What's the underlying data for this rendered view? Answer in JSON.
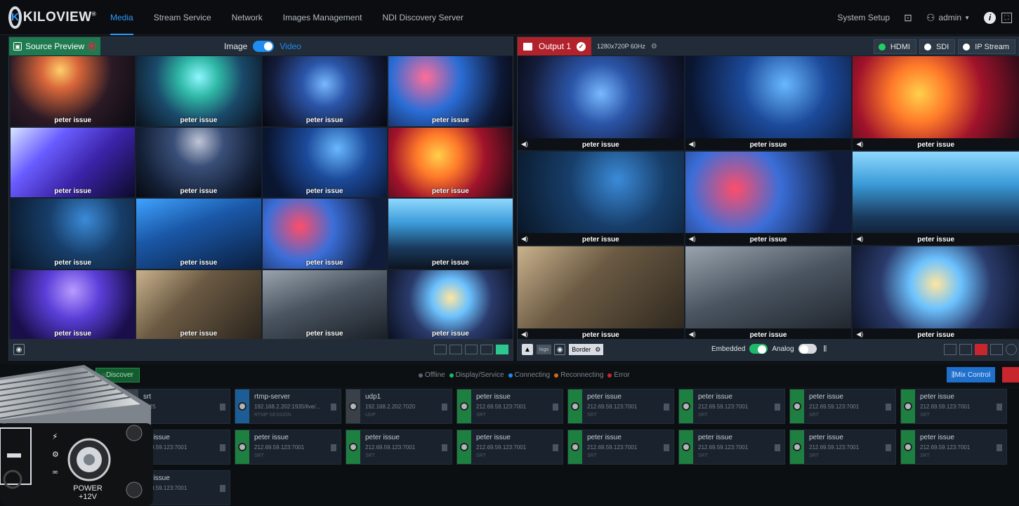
{
  "brand": {
    "name": "KILOVIEW",
    "mark": "®",
    "logo_letter": "K"
  },
  "nav": {
    "items": [
      {
        "label": "Media",
        "active": true
      },
      {
        "label": "Stream Service",
        "active": false
      },
      {
        "label": "Network",
        "active": false
      },
      {
        "label": "Images Management",
        "active": false
      },
      {
        "label": "NDI Discovery Server",
        "active": false
      }
    ]
  },
  "header": {
    "system_setup": "System Setup",
    "user": "admin",
    "info_icon": "i"
  },
  "source_preview": {
    "title": "Source Preview",
    "mode_image": "Image",
    "mode_video": "Video",
    "video_enabled": true,
    "tiles": [
      "peter issue",
      "peter issue",
      "peter issue",
      "peter issue",
      "peter issue",
      "peter issue",
      "peter issue",
      "peter issue",
      "peter issue",
      "peter issue",
      "peter issue",
      "peter issue",
      "peter issue",
      "peter issue",
      "peter issue",
      "peter issue"
    ],
    "layout_options": 5,
    "layout_selected": 5
  },
  "output": {
    "title": "Output 1",
    "resolution": "1280x720P 60Hz",
    "buttons": [
      {
        "label": "HDMI",
        "active": true
      },
      {
        "label": "SDI",
        "active": false
      },
      {
        "label": "IP Stream",
        "active": false
      }
    ],
    "tiles": [
      "peter issue",
      "peter issue",
      "peter issue",
      "peter issue",
      "peter issue",
      "peter issue",
      "peter issue",
      "peter issue",
      "peter issue"
    ],
    "footer": {
      "logo_btn": "logo",
      "border_label": "Border",
      "embedded_label": "Embedded",
      "embedded_on": true,
      "analog_label": "Analog",
      "analog_on": false
    }
  },
  "sources_bar": {
    "discover_label": "Discover",
    "legend": [
      {
        "label": "Offline",
        "color": "#5c6670"
      },
      {
        "label": "Display/Service",
        "color": "#1fb86a"
      },
      {
        "label": "Connecting",
        "color": "#1e8cf0"
      },
      {
        "label": "Reconnecting",
        "color": "#d26a1c"
      },
      {
        "label": "Error",
        "color": "#c8262f"
      }
    ],
    "mix_control_label": "Mix Control"
  },
  "sources": [
    {
      "name": "srt",
      "address": "6025",
      "proto": "",
      "status": "gray"
    },
    {
      "name": "rtmp-server",
      "address": "192.168.2.202:1935/live/...",
      "proto": "RTMP SESSION",
      "status": "blue"
    },
    {
      "name": "udp1",
      "address": "192.168.2.202:7020",
      "proto": "UDP",
      "status": "gray"
    },
    {
      "name": "peter issue",
      "address": "212.69.59.123:7001",
      "proto": "SRT",
      "status": "green"
    },
    {
      "name": "peter issue",
      "address": "212.69.59.123:7001",
      "proto": "SRT",
      "status": "green"
    },
    {
      "name": "peter issue",
      "address": "212.69.59.123:7001",
      "proto": "SRT",
      "status": "green"
    },
    {
      "name": "peter issue",
      "address": "212.69.59.123:7001",
      "proto": "SRT",
      "status": "green"
    },
    {
      "name": "peter issue",
      "address": "212.69.59.123:7001",
      "proto": "SRT",
      "status": "green"
    },
    {
      "name": "ter issue",
      "address": "2.69.59.123:7001",
      "proto": "",
      "status": "gray"
    },
    {
      "name": "peter issue",
      "address": "212.69.59.123:7001",
      "proto": "SRT",
      "status": "green"
    },
    {
      "name": "peter issue",
      "address": "212.69.59.123:7001",
      "proto": "SRT",
      "status": "green"
    },
    {
      "name": "peter issue",
      "address": "212.69.59.123:7001",
      "proto": "SRT",
      "status": "green"
    },
    {
      "name": "peter issue",
      "address": "212.69.59.123:7001",
      "proto": "SRT",
      "status": "green"
    },
    {
      "name": "peter issue",
      "address": "212.69.59.123:7001",
      "proto": "SRT",
      "status": "green"
    },
    {
      "name": "peter issue",
      "address": "212.69.59.123:7001",
      "proto": "SRT",
      "status": "green"
    },
    {
      "name": "peter issue",
      "address": "212.69.59.123:7001",
      "proto": "SRT",
      "status": "green"
    },
    {
      "name": "ter issue",
      "address": "2.69.59.123:7001",
      "proto": "",
      "status": "gray"
    }
  ],
  "device": {
    "power_label": "POWER",
    "voltage_label": "+12V"
  },
  "colors": {
    "accent": "#2f9bff",
    "green": "#1fb86a",
    "red": "#b2222d"
  }
}
